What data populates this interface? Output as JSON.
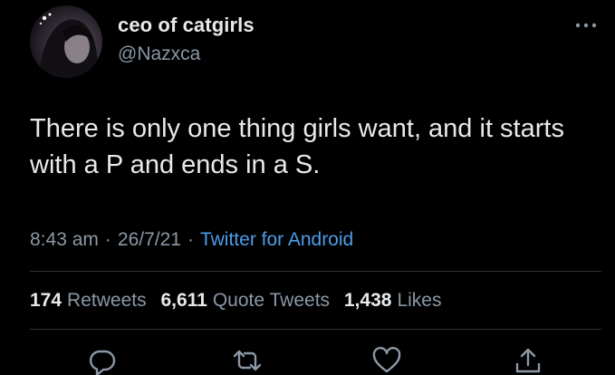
{
  "user": {
    "display_name": "ceo of catgirls",
    "handle": "@Nazxca",
    "avatar_icon": "user-avatar"
  },
  "tweet": {
    "text": "There is only one thing girls want, and it starts with a P and ends in a S."
  },
  "meta": {
    "time": "8:43 am",
    "separator": "·",
    "date": "26/7/21",
    "source": "Twitter for Android"
  },
  "stats": {
    "retweets_count": "174",
    "retweets_label": "Retweets",
    "quote_count": "6,611",
    "quote_label": "Quote Tweets",
    "likes_count": "1,438",
    "likes_label": "Likes"
  },
  "actions": {
    "reply_icon": "reply-icon",
    "retweet_icon": "retweet-icon",
    "like_icon": "heart-icon",
    "share_icon": "share-icon"
  },
  "colors": {
    "background": "#000000",
    "primary_text": "#e7e9ea",
    "secondary_text": "#8b98a5",
    "link": "#4a9eeb",
    "divider": "#2f3336"
  }
}
